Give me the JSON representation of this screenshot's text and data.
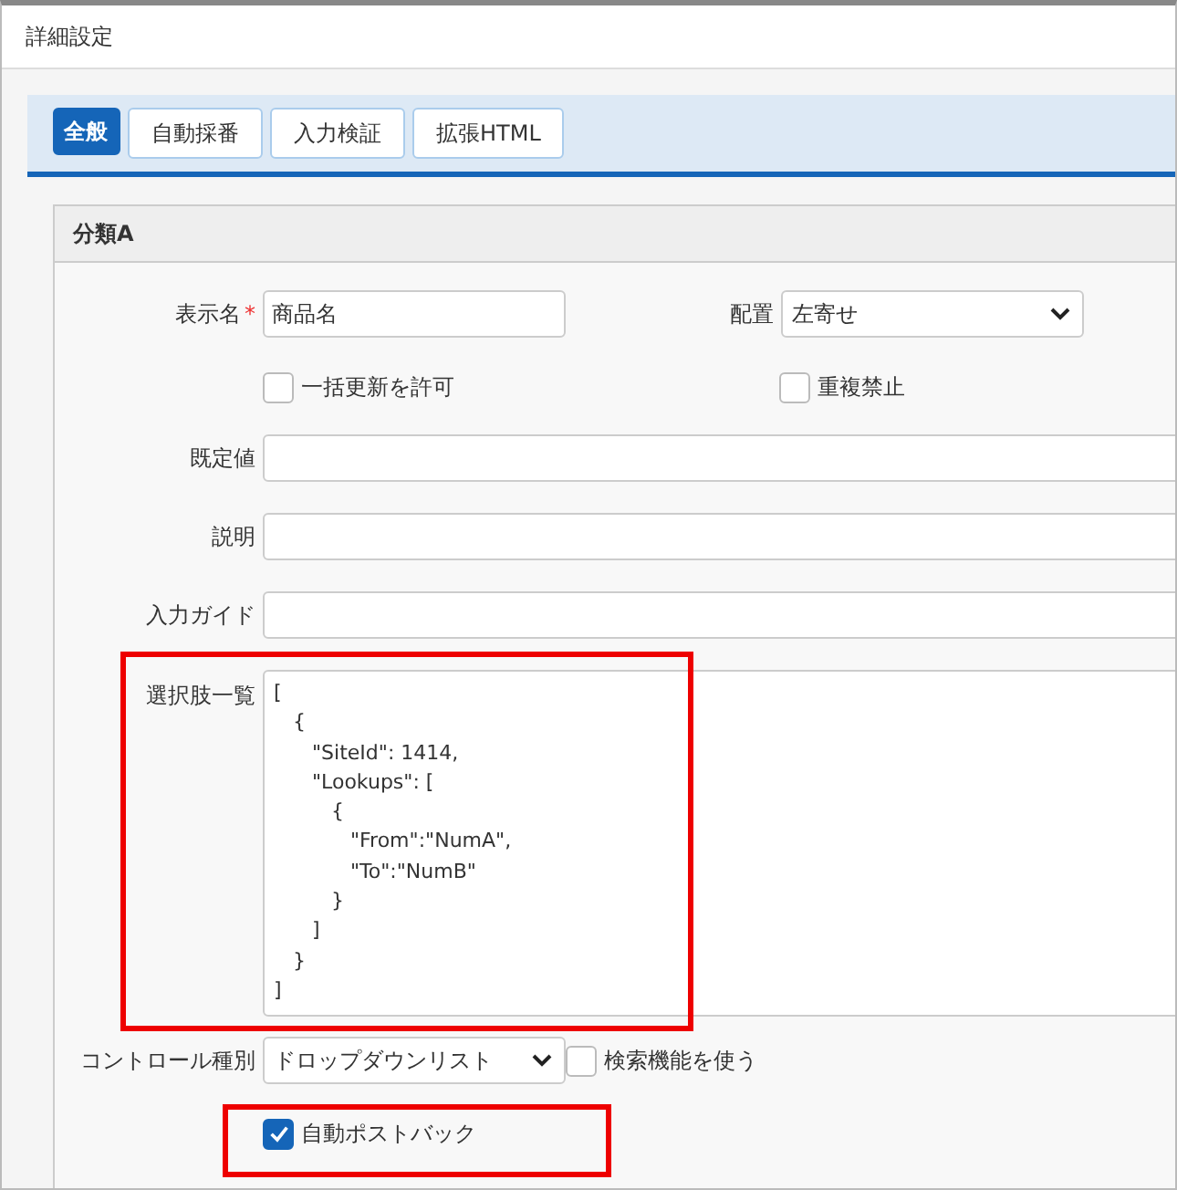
{
  "window": {
    "title": "詳細設定"
  },
  "tabs": [
    {
      "label": "全般",
      "selected": true
    },
    {
      "label": "自動採番",
      "selected": false
    },
    {
      "label": "入力検証",
      "selected": false
    },
    {
      "label": "拡張HTML",
      "selected": false
    }
  ],
  "section": {
    "title": "分類A"
  },
  "display_name": {
    "label": "表示名",
    "required_mark": "*",
    "value": "商品名"
  },
  "alignment": {
    "label": "配置",
    "value": "左寄せ"
  },
  "allow_bulk_update": {
    "label": "一括更新を許可",
    "checked": false
  },
  "no_duplicates": {
    "label": "重複禁止",
    "checked": false
  },
  "default_value": {
    "label": "既定値"
  },
  "description": {
    "label": "説明"
  },
  "input_guide": {
    "label": "入力ガイド"
  },
  "choices": {
    "label": "選択肢一覧",
    "value": "[\n   {\n      \"SiteId\": 1414,\n      \"Lookups\": [\n         {\n            \"From\":\"NumA\",\n            \"To\":\"NumB\"\n         }\n      ]\n   }\n]"
  },
  "control_type": {
    "label": "コントロール種別",
    "value": "ドロップダウンリスト"
  },
  "use_search": {
    "label": "検索機能を使う",
    "checked": false
  },
  "auto_postback": {
    "label": "自動ポストバック",
    "checked": true
  }
}
